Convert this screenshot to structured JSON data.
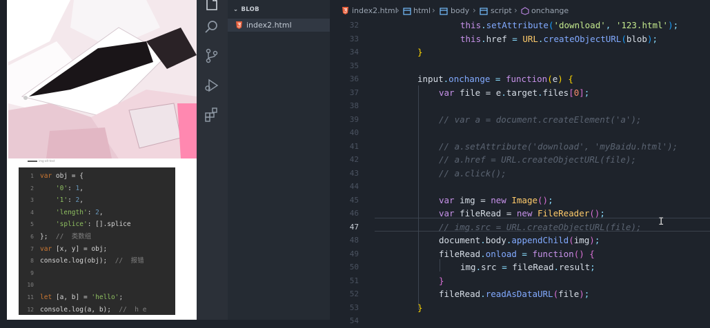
{
  "preview": {
    "caption": "img-alt-text",
    "snippet_lines": [
      {
        "n": "1",
        "tokens": [
          [
            "var",
            "s-key"
          ],
          [
            " obj = {",
            "s-plain"
          ]
        ]
      },
      {
        "n": "2",
        "tokens": [
          [
            "    ",
            "s-plain"
          ],
          [
            "'0'",
            "s-str"
          ],
          [
            ": ",
            "s-plain"
          ],
          [
            "1",
            "s-num"
          ],
          [
            ",",
            "s-plain"
          ]
        ]
      },
      {
        "n": "3",
        "tokens": [
          [
            "    ",
            "s-plain"
          ],
          [
            "'1'",
            "s-str"
          ],
          [
            ": ",
            "s-plain"
          ],
          [
            "2",
            "s-num"
          ],
          [
            ",",
            "s-plain"
          ]
        ]
      },
      {
        "n": "4",
        "tokens": [
          [
            "    ",
            "s-plain"
          ],
          [
            "'length'",
            "s-str"
          ],
          [
            ": ",
            "s-plain"
          ],
          [
            "2",
            "s-num"
          ],
          [
            ",",
            "s-plain"
          ]
        ]
      },
      {
        "n": "5",
        "tokens": [
          [
            "    ",
            "s-plain"
          ],
          [
            "'splice'",
            "s-str"
          ],
          [
            ": [].splice",
            "s-plain"
          ]
        ]
      },
      {
        "n": "6",
        "tokens": [
          [
            "};  ",
            "s-plain"
          ],
          [
            "//  类数组",
            "s-com"
          ]
        ]
      },
      {
        "n": "7",
        "tokens": [
          [
            "var",
            "s-key"
          ],
          [
            " [x, y] = obj;",
            "s-plain"
          ]
        ]
      },
      {
        "n": "8",
        "tokens": [
          [
            "console.log(obj);  ",
            "s-plain"
          ],
          [
            "//  报错",
            "s-com"
          ]
        ]
      },
      {
        "n": "9",
        "tokens": []
      },
      {
        "n": "10",
        "tokens": []
      },
      {
        "n": "11",
        "tokens": [
          [
            "let",
            "s-key"
          ],
          [
            " [a, b] = ",
            "s-plain"
          ],
          [
            "'hello'",
            "s-str"
          ],
          [
            ";",
            "s-plain"
          ]
        ]
      },
      {
        "n": "12",
        "tokens": [
          [
            "console.log(a, b);  ",
            "s-plain"
          ],
          [
            "//  h e",
            "s-com"
          ]
        ]
      }
    ]
  },
  "activity_bar": {
    "icons": [
      "files-icon",
      "search-icon",
      "source-control-icon",
      "run-debug-icon",
      "extensions-icon"
    ]
  },
  "explorer": {
    "section_title": "BLOB",
    "file": "index2.html"
  },
  "breadcrumb": {
    "items": [
      "index2.html",
      "html",
      "body",
      "script",
      "onchange"
    ]
  },
  "editor": {
    "current_line": "47",
    "lines": [
      {
        "n": "32",
        "indent": 2,
        "tokens": [
          [
            "this",
            "t-keyword"
          ],
          [
            ".",
            "t-punct"
          ],
          [
            "setAttribute",
            "t-func"
          ],
          [
            "(",
            "t-bracket3"
          ],
          [
            "'download'",
            "t-string"
          ],
          [
            ", ",
            "t-punct"
          ],
          [
            "'123.html'",
            "t-string"
          ],
          [
            ")",
            "t-bracket3"
          ],
          [
            ";",
            "t-punct"
          ]
        ]
      },
      {
        "n": "33",
        "indent": 2,
        "tokens": [
          [
            "this",
            "t-keyword"
          ],
          [
            ".",
            "t-punct"
          ],
          [
            "href",
            "t-default"
          ],
          [
            " = ",
            "t-punct"
          ],
          [
            "URL",
            "t-cls"
          ],
          [
            ".",
            "t-punct"
          ],
          [
            "createObjectURL",
            "t-func"
          ],
          [
            "(",
            "t-bracket3"
          ],
          [
            "blob",
            "t-default"
          ],
          [
            ")",
            "t-bracket3"
          ],
          [
            ";",
            "t-punct"
          ]
        ]
      },
      {
        "n": "34",
        "indent": 0,
        "tokens": [
          [
            "}",
            "t-bracket1"
          ]
        ]
      },
      {
        "n": "35",
        "indent": 0,
        "tokens": []
      },
      {
        "n": "36",
        "indent": 0,
        "tokens": [
          [
            "input",
            "t-default"
          ],
          [
            ".",
            "t-punct"
          ],
          [
            "onchange",
            "t-func"
          ],
          [
            " = ",
            "t-punct"
          ],
          [
            "function",
            "t-keyword"
          ],
          [
            "(",
            "t-bracket1"
          ],
          [
            "e",
            "t-default"
          ],
          [
            ")",
            "t-bracket1"
          ],
          [
            " ",
            "t-default"
          ],
          [
            "{",
            "t-bracket1"
          ]
        ]
      },
      {
        "n": "37",
        "indent": 1,
        "tokens": [
          [
            "var",
            "t-keyword"
          ],
          [
            " file = ",
            "t-default"
          ],
          [
            "e",
            "t-default"
          ],
          [
            ".",
            "t-punct"
          ],
          [
            "target",
            "t-default"
          ],
          [
            ".",
            "t-punct"
          ],
          [
            "files",
            "t-default"
          ],
          [
            "[",
            "t-bracket2"
          ],
          [
            "0",
            "t-number"
          ],
          [
            "]",
            "t-bracket2"
          ],
          [
            ";",
            "t-punct"
          ]
        ]
      },
      {
        "n": "38",
        "indent": 1,
        "tokens": []
      },
      {
        "n": "39",
        "indent": 1,
        "tokens": [
          [
            "// var a = document.createElement('a');",
            "t-comment"
          ]
        ]
      },
      {
        "n": "40",
        "indent": 1,
        "tokens": []
      },
      {
        "n": "41",
        "indent": 1,
        "tokens": [
          [
            "// a.setAttribute('download', 'myBaidu.html');",
            "t-comment"
          ]
        ]
      },
      {
        "n": "42",
        "indent": 1,
        "tokens": [
          [
            "// a.href = URL.createObjectURL(file);",
            "t-comment"
          ]
        ]
      },
      {
        "n": "43",
        "indent": 1,
        "tokens": [
          [
            "// a.click();",
            "t-comment"
          ]
        ]
      },
      {
        "n": "44",
        "indent": 1,
        "tokens": []
      },
      {
        "n": "45",
        "indent": 1,
        "tokens": [
          [
            "var",
            "t-keyword"
          ],
          [
            " img = ",
            "t-default"
          ],
          [
            "new",
            "t-keyword"
          ],
          [
            " ",
            "t-default"
          ],
          [
            "Image",
            "t-cls"
          ],
          [
            "(",
            "t-bracket2"
          ],
          [
            ")",
            "t-bracket2"
          ],
          [
            ";",
            "t-punct"
          ]
        ]
      },
      {
        "n": "46",
        "indent": 1,
        "tokens": [
          [
            "var",
            "t-keyword"
          ],
          [
            " fileRead = ",
            "t-default"
          ],
          [
            "new",
            "t-keyword"
          ],
          [
            " ",
            "t-default"
          ],
          [
            "FileReader",
            "t-cls"
          ],
          [
            "(",
            "t-bracket2"
          ],
          [
            ")",
            "t-bracket2"
          ],
          [
            ";",
            "t-punct"
          ]
        ]
      },
      {
        "n": "47",
        "indent": 1,
        "tokens": [
          [
            "// img.src = URL.createObjectURL(file);",
            "t-comment"
          ]
        ]
      },
      {
        "n": "48",
        "indent": 1,
        "tokens": [
          [
            "document",
            "t-default"
          ],
          [
            ".",
            "t-punct"
          ],
          [
            "body",
            "t-default"
          ],
          [
            ".",
            "t-punct"
          ],
          [
            "appendChild",
            "t-func"
          ],
          [
            "(",
            "t-bracket2"
          ],
          [
            "img",
            "t-default"
          ],
          [
            ")",
            "t-bracket2"
          ],
          [
            ";",
            "t-punct"
          ]
        ]
      },
      {
        "n": "49",
        "indent": 1,
        "tokens": [
          [
            "fileRead",
            "t-default"
          ],
          [
            ".",
            "t-punct"
          ],
          [
            "onload",
            "t-func"
          ],
          [
            " = ",
            "t-punct"
          ],
          [
            "function",
            "t-keyword"
          ],
          [
            "(",
            "t-bracket2"
          ],
          [
            ")",
            "t-bracket2"
          ],
          [
            " ",
            "t-default"
          ],
          [
            "{",
            "t-bracket2"
          ]
        ]
      },
      {
        "n": "50",
        "indent": 2,
        "tokens": [
          [
            "img",
            "t-default"
          ],
          [
            ".",
            "t-punct"
          ],
          [
            "src",
            "t-default"
          ],
          [
            " = ",
            "t-punct"
          ],
          [
            "fileRead",
            "t-default"
          ],
          [
            ".",
            "t-punct"
          ],
          [
            "result",
            "t-default"
          ],
          [
            ";",
            "t-punct"
          ]
        ]
      },
      {
        "n": "51",
        "indent": 1,
        "tokens": [
          [
            "}",
            "t-bracket2"
          ]
        ]
      },
      {
        "n": "52",
        "indent": 1,
        "tokens": [
          [
            "fileRead",
            "t-default"
          ],
          [
            ".",
            "t-punct"
          ],
          [
            "readAsDataURL",
            "t-func"
          ],
          [
            "(",
            "t-bracket2"
          ],
          [
            "file",
            "t-default"
          ],
          [
            ")",
            "t-bracket2"
          ],
          [
            ";",
            "t-punct"
          ]
        ]
      },
      {
        "n": "53",
        "indent": 0,
        "tokens": [
          [
            "}",
            "t-bracket1"
          ]
        ]
      },
      {
        "n": "54",
        "indent": 0,
        "tokens": []
      }
    ]
  }
}
